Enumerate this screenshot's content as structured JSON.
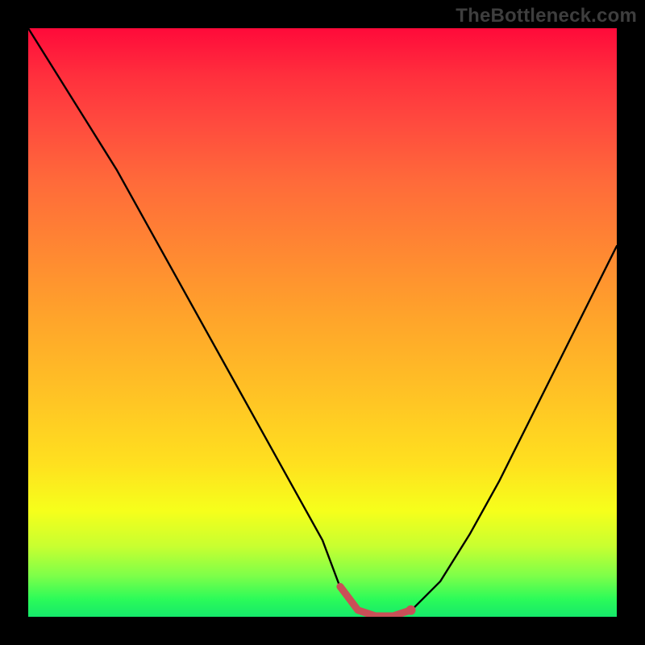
{
  "watermark": "TheBottleneck.com",
  "chart_data": {
    "type": "line",
    "title": "",
    "xlabel": "",
    "ylabel": "",
    "xlim": [
      0,
      100
    ],
    "ylim": [
      0,
      100
    ],
    "x": [
      0,
      5,
      10,
      15,
      20,
      25,
      30,
      35,
      40,
      45,
      50,
      53,
      56,
      59,
      62,
      65,
      70,
      75,
      80,
      85,
      90,
      95,
      100
    ],
    "values": [
      100,
      92,
      84,
      76,
      67,
      58,
      49,
      40,
      31,
      22,
      13,
      5,
      1,
      0,
      0,
      1,
      6,
      14,
      23,
      33,
      43,
      53,
      63
    ],
    "flat_zone_x": [
      53,
      65
    ],
    "grid": false,
    "legend": false,
    "colors": {
      "curve": "#000000",
      "flat_marker": "#c94f57",
      "gradient_top": "#ff0a3a",
      "gradient_bottom": "#15e86a"
    }
  }
}
